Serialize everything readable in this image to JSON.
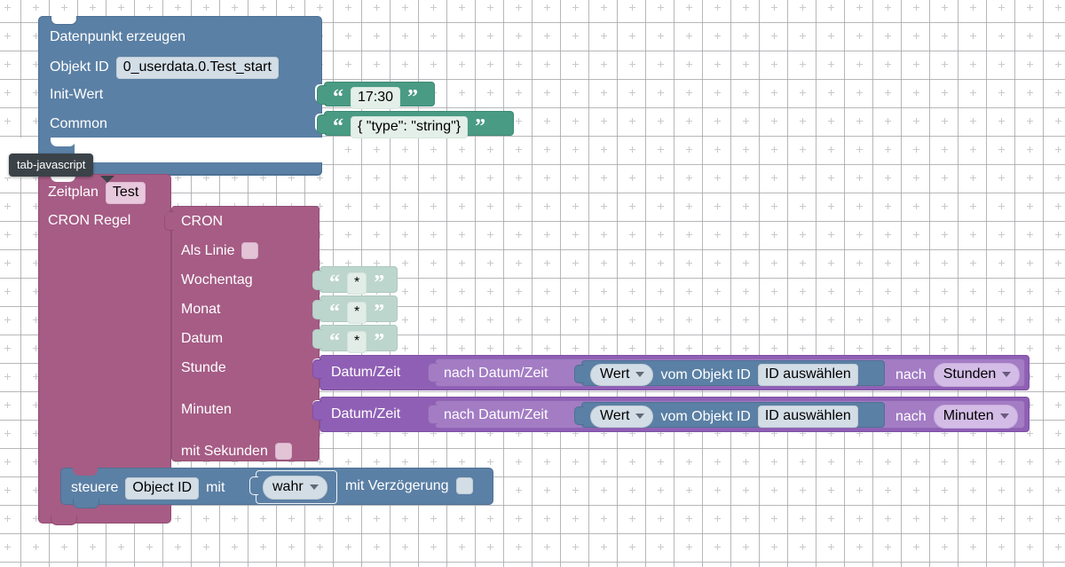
{
  "workspace": {
    "name": "blockly-workspace",
    "background_color": "#ffffff",
    "grid_color": "#c9c9ce",
    "grid_spacing": 32
  },
  "tooltip": {
    "text": "tab-javascript"
  },
  "colors": {
    "blue": "#5b80a5",
    "magenta": "#a65c85",
    "purple": "#8f5fb5",
    "purple_light": "#a37cc4",
    "green": "#4a9b84",
    "green_muted": "#bdd6cd",
    "field": "#d3dde6",
    "tooltip_bg": "#3b4248"
  },
  "blocks": {
    "create_state": {
      "title": "Datenpunkt erzeugen",
      "object_id_label": "Objekt ID",
      "object_id_value": "0_userdata.0.Test_start",
      "init_value_label": "Init-Wert",
      "common_label": "Common",
      "init_value_string": "17:30",
      "common_string": "{ \"type\": \"string\"}"
    },
    "schedule": {
      "title_label": "Zeitplan",
      "title_value": "Test",
      "cron_rule_label": "CRON Regel"
    },
    "cron": {
      "title": "CRON",
      "as_line_label": "Als Linie",
      "as_line_checked": false,
      "weekday_label": "Wochentag",
      "weekday_value": "*",
      "month_label": "Monat",
      "month_value": "*",
      "date_label": "Datum",
      "date_value": "*",
      "hour_label": "Stunde",
      "minute_label": "Minuten",
      "with_seconds_label": "mit Sekunden",
      "with_seconds_checked": false
    },
    "datetime_hour": {
      "datetime_label": "Datum/Zeit",
      "by_datetime_label": "nach Datum/Zeit",
      "value_dropdown": "Wert",
      "from_object_label": "vom Objekt ID",
      "object_id_value": "ID auswählen",
      "after_label": "nach",
      "unit_dropdown": "Stunden"
    },
    "datetime_minute": {
      "datetime_label": "Datum/Zeit",
      "by_datetime_label": "nach Datum/Zeit",
      "value_dropdown": "Wert",
      "from_object_label": "vom Objekt ID",
      "object_id_value": "ID auswählen",
      "after_label": "nach",
      "unit_dropdown": "Minuten"
    },
    "control": {
      "control_label": "steuere",
      "object_id_value": "Object ID",
      "with_label": "mit",
      "value_dropdown": "wahr",
      "delay_label": "mit Verzögerung",
      "delay_checked": false
    }
  }
}
